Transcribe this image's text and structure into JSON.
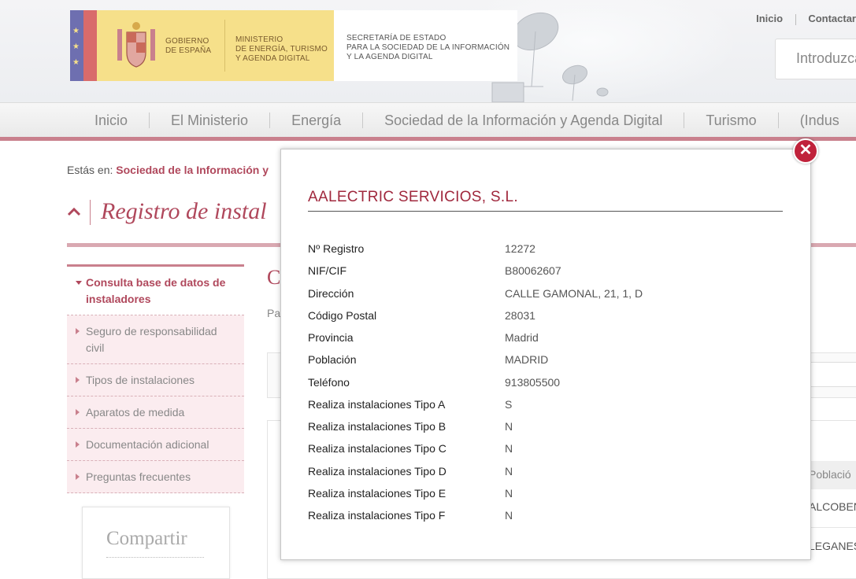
{
  "header": {
    "logo": {
      "gobierno": "GOBIERNO DE ESPAÑA",
      "gobierno_lines": [
        "GOBIERNO",
        "DE ESPAÑA"
      ],
      "ministerio_lines": [
        "MINISTERIO",
        "DE ENERGÍA, TURISMO",
        "Y AGENDA DIGITAL"
      ],
      "secretaria_lines": [
        "SECRETARÍA DE ESTADO",
        "PARA LA SOCIEDAD DE LA INFORMACIÓN",
        "Y LA AGENDA DIGITAL"
      ]
    },
    "top_links": [
      "Inicio",
      "Contactar"
    ],
    "search_placeholder": "Introduzca"
  },
  "nav": {
    "items": [
      "Inicio",
      "El Ministerio",
      "Energía",
      "Sociedad de la Información y Agenda Digital",
      "Turismo",
      "(Indus"
    ]
  },
  "breadcrumb": {
    "label": "Estás en:",
    "link": "Sociedad de la Información y"
  },
  "page_title": "Registro de instal",
  "sidebar": {
    "items": [
      {
        "label": "Consulta base de datos de instaladores",
        "active": true
      },
      {
        "label": "Seguro de responsabilidad civil",
        "active": false
      },
      {
        "label": "Tipos de instalaciones",
        "active": false
      },
      {
        "label": "Aparatos de medida",
        "active": false
      },
      {
        "label": "Documentación adicional",
        "active": false
      },
      {
        "label": "Preguntas frecuentes",
        "active": false
      }
    ],
    "share_title": "Compartir"
  },
  "background": {
    "heading_fragment": "C",
    "text_fragment": "Pa",
    "table_header": "Població",
    "rows": [
      "ALCOBEN",
      "LEGANES"
    ]
  },
  "modal": {
    "title": "AALECTRIC SERVICIOS, S.L.",
    "close_symbol": "✕",
    "fields": [
      {
        "label": "Nº Registro",
        "value": "12272"
      },
      {
        "label": "NIF/CIF",
        "value": "B80062607"
      },
      {
        "label": "Dirección",
        "value": "CALLE GAMONAL, 21, 1, D"
      },
      {
        "label": "Código Postal",
        "value": "28031"
      },
      {
        "label": "Provincia",
        "value": "Madrid"
      },
      {
        "label": "Población",
        "value": "MADRID"
      },
      {
        "label": "Teléfono",
        "value": "913805500"
      },
      {
        "label": "Realiza instalaciones Tipo A",
        "value": "S"
      },
      {
        "label": "Realiza instalaciones Tipo B",
        "value": "N"
      },
      {
        "label": "Realiza instalaciones Tipo C",
        "value": "N"
      },
      {
        "label": "Realiza instalaciones Tipo D",
        "value": "N"
      },
      {
        "label": "Realiza instalaciones Tipo E",
        "value": "N"
      },
      {
        "label": "Realiza instalaciones Tipo F",
        "value": "N"
      }
    ]
  },
  "colors": {
    "brand": "#b0485c",
    "accent_bar": "#c9808d",
    "modal_title": "#a0283d",
    "close_button": "#c0223b"
  }
}
